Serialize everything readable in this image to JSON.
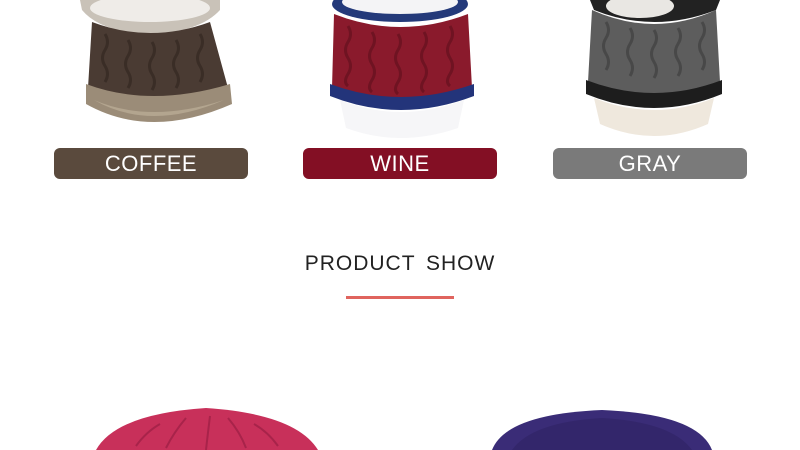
{
  "variants": [
    {
      "label": "COFFEE",
      "color": "#5a4a3d"
    },
    {
      "label": "WINE",
      "color": "#830f24"
    },
    {
      "label": "GRAY",
      "color": "#7a7a7a"
    }
  ],
  "section": {
    "title": "PRODUCT SHOW",
    "underline_color": "#e0645e"
  },
  "show_items": [
    {
      "name": "rose hat",
      "color": "#c8305a"
    },
    {
      "name": "navy hat",
      "color": "#3a2c77"
    }
  ]
}
